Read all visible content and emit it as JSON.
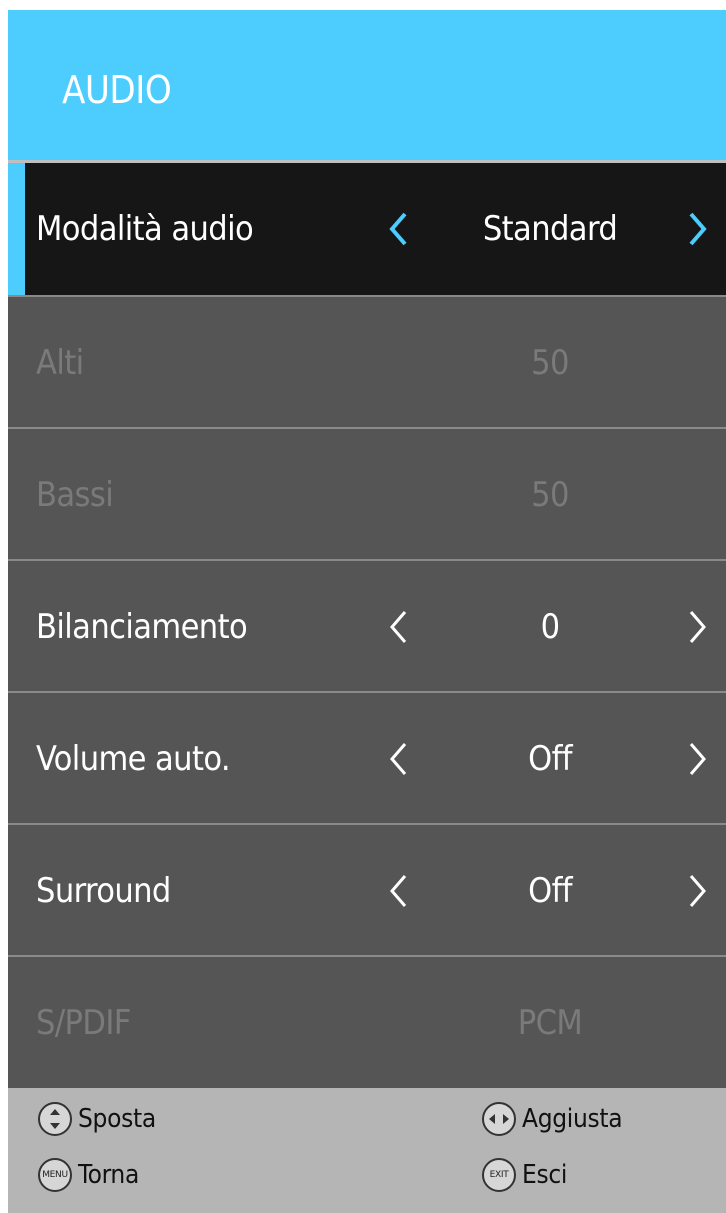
{
  "header": {
    "title": "AUDIO"
  },
  "accent_color": "#4ccdfd",
  "rows": [
    {
      "label": "Modalità audio",
      "value": "Standard",
      "state": "selected"
    },
    {
      "label": "Alti",
      "value": "50",
      "state": "disabled"
    },
    {
      "label": "Bassi",
      "value": "50",
      "state": "disabled"
    },
    {
      "label": "Bilanciamento",
      "value": "0",
      "state": "normal"
    },
    {
      "label": "Volume auto.",
      "value": "Off",
      "state": "normal"
    },
    {
      "label": "Surround",
      "value": "Off",
      "state": "normal"
    },
    {
      "label": "S/PDIF",
      "value": "PCM",
      "state": "disabled"
    }
  ],
  "footer": {
    "move": {
      "icon": "up-down-icon",
      "label": "Sposta"
    },
    "adjust": {
      "icon": "left-right-icon",
      "label": "Aggiusta"
    },
    "back": {
      "icon": "menu-button-icon",
      "icon_text": "MENU",
      "label": "Torna"
    },
    "exit": {
      "icon": "exit-button-icon",
      "icon_text": "EXIT",
      "label": "Esci"
    }
  }
}
